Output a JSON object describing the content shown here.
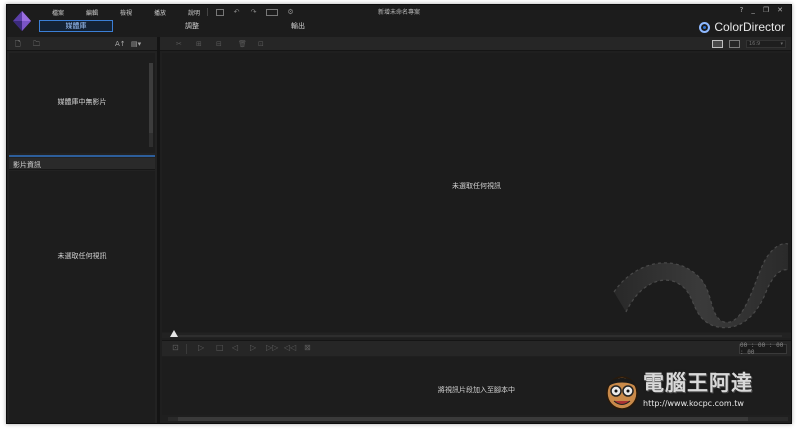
{
  "menu": [
    "檔案",
    "編輯",
    "檢視",
    "播放",
    "說明"
  ],
  "toolbar_glyphs": {
    "undo": "↶",
    "redo": "↷",
    "settings": "⚙"
  },
  "project_title": "新增未命名專案",
  "window_controls": [
    "?",
    "_",
    "❐",
    "✕"
  ],
  "tabs": [
    {
      "label": "媒體庫",
      "active": true
    },
    {
      "label": "調整",
      "active": false
    },
    {
      "label": "輸出",
      "active": false
    }
  ],
  "brand": {
    "name": "ColorDirector",
    "accent": "#2a6fd1"
  },
  "library": {
    "sort_label": "A↑",
    "empty_text": "媒體庫中無影片"
  },
  "clip_info": {
    "header": "影片資訊",
    "empty_text": "未選取任何視訊"
  },
  "edit_tools": [
    "✂",
    "⊞",
    "⊟",
    "🗑",
    "⊡"
  ],
  "preview": {
    "empty_text": "未選取任何視訊",
    "ratio_label": "16:9"
  },
  "transport": {
    "buttons": [
      "⊡",
      "▷",
      "□",
      "◁",
      "▷",
      "▷▷",
      "◁◁",
      "⊠"
    ],
    "timecode": "00 : 00 : 00 : 00"
  },
  "storyboard": {
    "hint": "將視訊片段加入至腳本中"
  },
  "watermark": {
    "title": "電腦王阿達",
    "url": "http://www.kocpc.com.tw"
  }
}
